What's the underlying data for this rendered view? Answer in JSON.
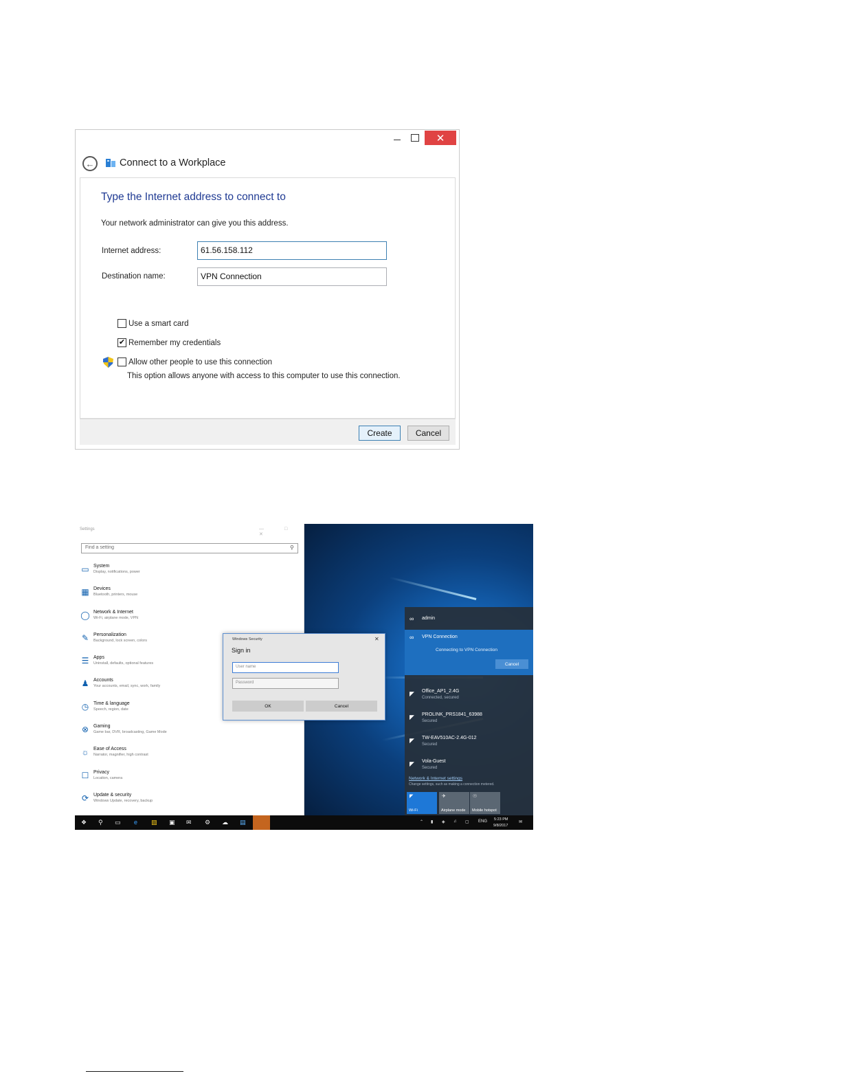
{
  "wizard": {
    "close_glyph": "✕",
    "title": "Connect to a Workplace",
    "heading": "Type the Internet address to connect to",
    "subtext": "Your network administrator can give you this address.",
    "address_label": "Internet address:",
    "address_value": "61.56.158.112",
    "destination_label": "Destination name:",
    "destination_value": "VPN Connection",
    "smart_card_label": "Use a smart card",
    "smart_card_checked": false,
    "remember_label": "Remember my credentials",
    "remember_checked": true,
    "remember_check_glyph": "✔",
    "allow_label": "Allow other people to use this connection",
    "allow_checked": false,
    "allow_note": "This option allows anyone with access to this computer to use this connection.",
    "create_label": "Create",
    "cancel_label": "Cancel",
    "back_glyph": "←",
    "accent": "#1f3a93"
  },
  "settings": {
    "title": "Settings",
    "controls": "— □ ✕",
    "search_placeholder": "Find a setting",
    "categories": [
      {
        "name": "System",
        "desc": "Display, notifications, power",
        "icon": "laptop-icon"
      },
      {
        "name": "Devices",
        "desc": "Bluetooth, printers, mouse",
        "icon": "keyboard-icon"
      },
      {
        "name": "Network & Internet",
        "desc": "Wi-Fi, airplane mode, VPN",
        "icon": "globe-icon"
      },
      {
        "name": "Personalization",
        "desc": "Background, lock screen, colors",
        "icon": "paint-icon"
      },
      {
        "name": "Apps",
        "desc": "Uninstall, defaults, optional features",
        "icon": "list-icon"
      },
      {
        "name": "Accounts",
        "desc": "Your accounts, email, sync, work, family",
        "icon": "person-icon"
      },
      {
        "name": "Time & language",
        "desc": "Speech, region, date",
        "icon": "clock-icon"
      },
      {
        "name": "Gaming",
        "desc": "Game bar, DVR, broadcasting, Game Mode",
        "icon": "xbox-icon"
      },
      {
        "name": "Ease of Access",
        "desc": "Narrator, magnifier, high contrast",
        "icon": "accessibility-icon"
      },
      {
        "name": "Privacy",
        "desc": "Location, camera",
        "icon": "lock-icon"
      },
      {
        "name": "Update & security",
        "desc": "Windows Update, recovery, backup",
        "icon": "sync-icon"
      }
    ]
  },
  "security": {
    "title": "Windows Security",
    "close_glyph": "✕",
    "heading": "Sign in",
    "user_placeholder": "User name",
    "password_placeholder": "Password",
    "ok_label": "OK",
    "cancel_label": "Cancel"
  },
  "flyout": {
    "account": "admin",
    "vpn_name": "VPN Connection",
    "vpn_status": "Connecting to VPN Connection",
    "vpn_cancel": "Cancel",
    "networks": [
      {
        "name": "Office_AP1_2.4G",
        "status": "Connected, secured"
      },
      {
        "name": "PROLINK_PRS1841_63988",
        "status": "Secured"
      },
      {
        "name": "TW-EAV510AC-2.4G-012",
        "status": "Secured"
      },
      {
        "name": "Vola-Guest",
        "status": "Secured"
      }
    ],
    "settings_link": "Network & Internet settings",
    "settings_sub": "Change settings, such as making a connection metered.",
    "tiles": [
      {
        "label": "Wi-Fi"
      },
      {
        "label": "Airplane mode"
      },
      {
        "label": "Mobile hotspot"
      }
    ]
  },
  "taskbar": {
    "language": "ENG",
    "time": "5:23 PM",
    "date": "9/8/2017"
  }
}
